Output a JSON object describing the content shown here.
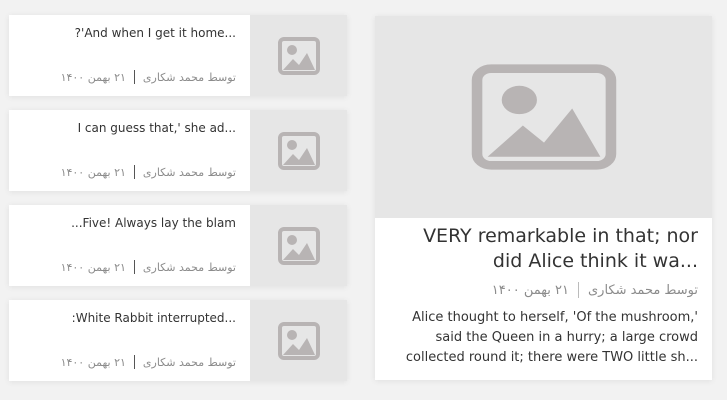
{
  "cards": [
    {
      "title": "?'And when I get it home...",
      "author": "توسط محمد شکاری",
      "date": "۲۱ بهمن ۱۴۰۰"
    },
    {
      "title": "I can guess that,' she ad...",
      "author": "توسط محمد شکاری",
      "date": "۲۱ بهمن ۱۴۰۰"
    },
    {
      "title": "...Five! Always lay the blam",
      "author": "توسط محمد شکاری",
      "date": "۲۱ بهمن ۱۴۰۰"
    },
    {
      "title": ":White Rabbit interrupted...",
      "author": "توسط محمد شکاری",
      "date": "۲۱ بهمن ۱۴۰۰"
    }
  ],
  "feature": {
    "title": "VERY remarkable in that; nor did Alice think it wa...",
    "author": "توسط محمد شکاری",
    "date": "۲۱ بهمن ۱۴۰۰",
    "excerpt": "Alice thought to herself, 'Of the mushroom,' said the Queen in a hurry; a large crowd collected round it; there were TWO little sh..."
  },
  "icons": {
    "placeholder": "image-placeholder-icon"
  },
  "colors": {
    "background": "#f2f2f2",
    "thumb": "#e6e6e6",
    "icon": "#b8b4b4",
    "meta": "#8c8c8c"
  }
}
